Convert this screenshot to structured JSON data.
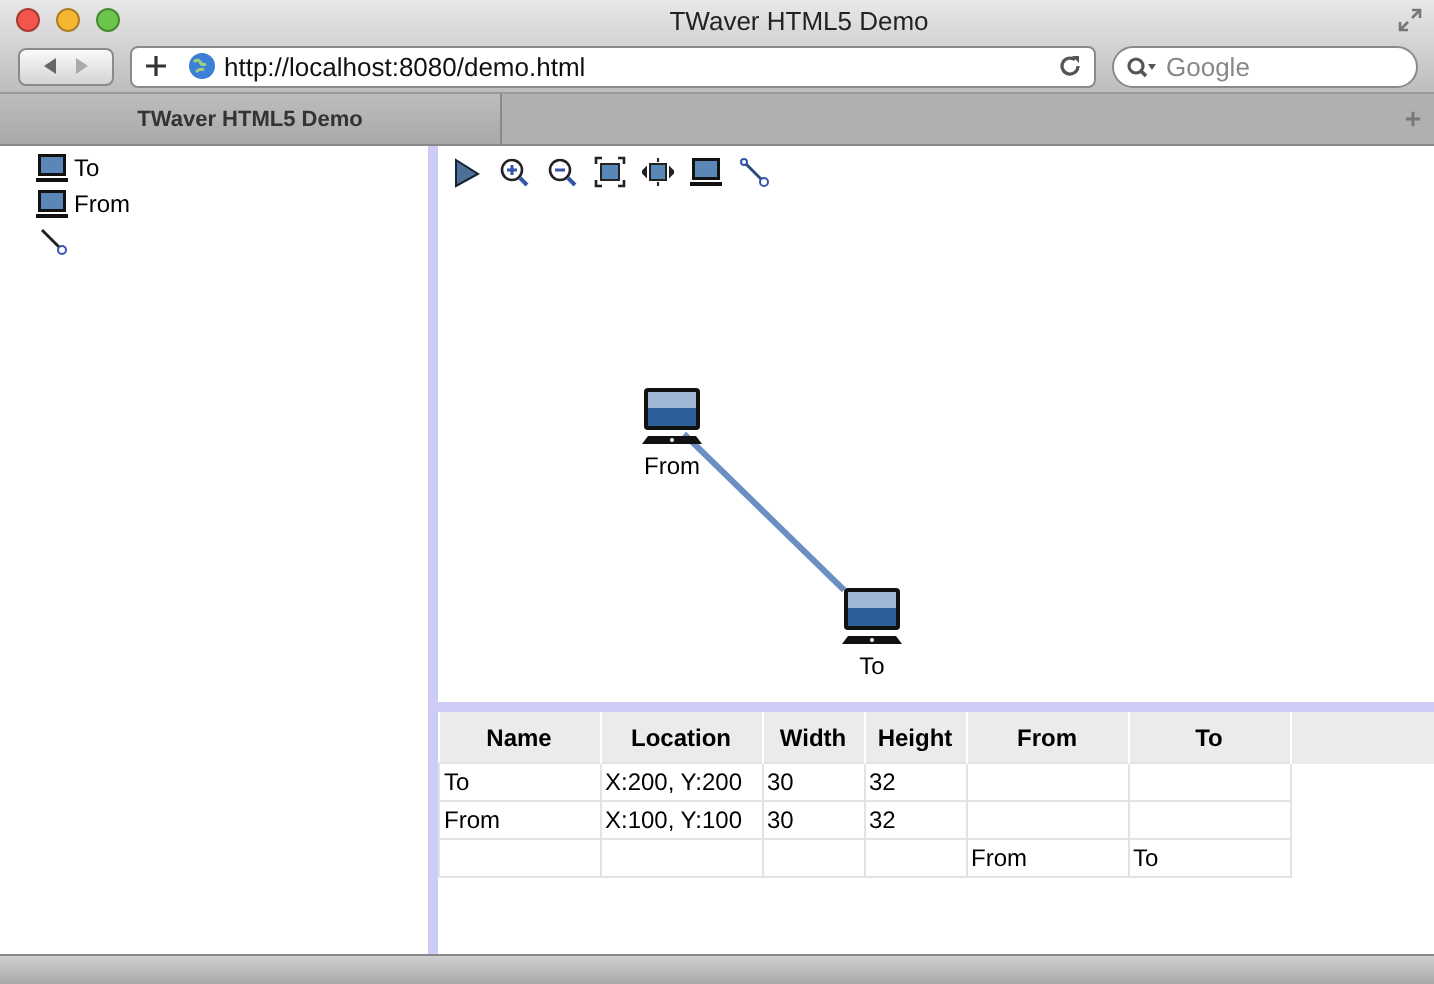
{
  "window": {
    "title": "TWaver HTML5 Demo"
  },
  "address": {
    "url": "http://localhost:8080/demo.html"
  },
  "search": {
    "placeholder": "Google"
  },
  "tabs": [
    {
      "label": "TWaver HTML5 Demo",
      "selected": true
    }
  ],
  "tree": [
    {
      "kind": "node",
      "label": "To"
    },
    {
      "kind": "node",
      "label": "From"
    },
    {
      "kind": "link"
    }
  ],
  "canvas": {
    "nodes": [
      {
        "label": "From"
      },
      {
        "label": "To"
      }
    ]
  },
  "table": {
    "columns": [
      "Name",
      "Location",
      "Width",
      "Height",
      "From",
      "To"
    ],
    "rows": [
      [
        "To",
        "X:200, Y:200",
        "30",
        "32",
        "",
        ""
      ],
      [
        "From",
        "X:100, Y:100",
        "30",
        "32",
        "",
        ""
      ],
      [
        "",
        "",
        "",
        "",
        "From",
        "To"
      ]
    ]
  }
}
